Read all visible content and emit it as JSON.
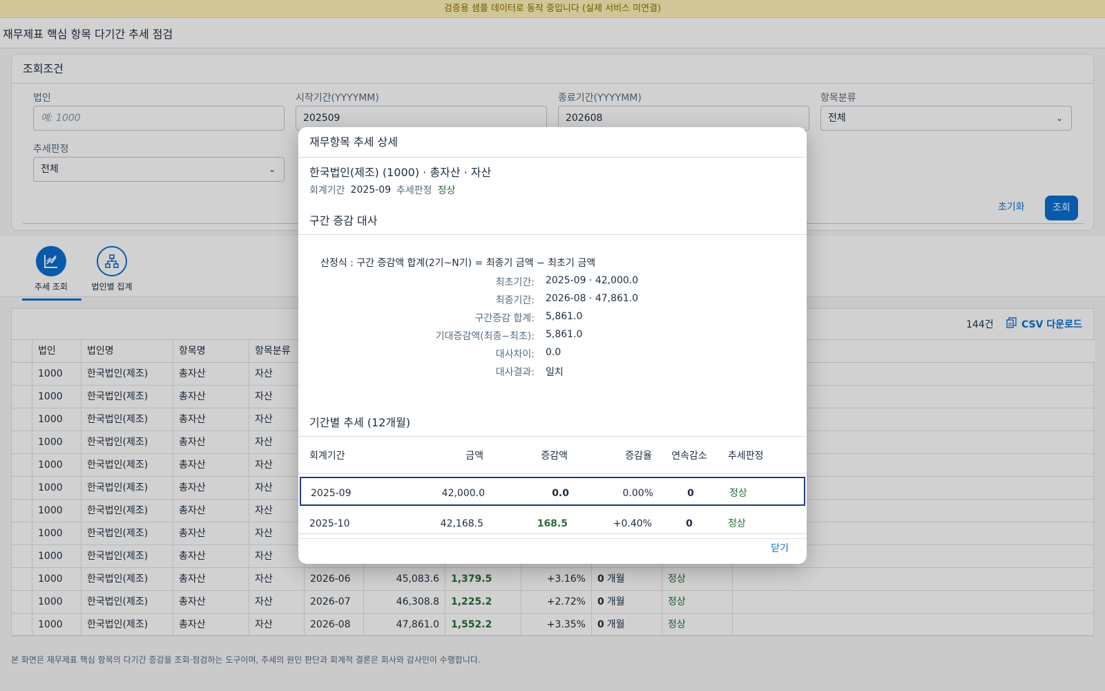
{
  "banner": "검증용 샘플 데이터로 동작 중입니다 (실제 서비스 미연결)",
  "app_title": "재무제표 핵심 항목 다기간 추세 점검",
  "filters": {
    "header": "조회조건",
    "entity_label": "법인",
    "entity_placeholder": "예: 1000",
    "start_label": "시작기간(YYYYMM)",
    "start_value": "202509",
    "end_label": "종료기간(YYYYMM)",
    "end_value": "202608",
    "category_label": "항목분류",
    "category_value": "전체",
    "trend_label": "추세판정",
    "trend_value": "전체",
    "reset_label": "초기화",
    "search_label": "조회"
  },
  "tabs": [
    {
      "label": "추세 조회",
      "icon": "line-chart-icon"
    },
    {
      "label": "법인별 집계",
      "icon": "org-hierarchy-icon"
    }
  ],
  "table": {
    "count": "144건",
    "csv_label": "CSV 다운로드",
    "columns": [
      "법인",
      "법인명",
      "항목명",
      "항목분류"
    ],
    "rows": [
      {
        "entity": "1000",
        "entity_name": "한국법인(제조)",
        "item": "총자산",
        "category": "자산",
        "period": "",
        "amount": "",
        "change": "",
        "rate": "",
        "streak": "",
        "unit": "",
        "trend": ""
      },
      {
        "entity": "1000",
        "entity_name": "한국법인(제조)",
        "item": "총자산",
        "category": "자산",
        "period": "",
        "amount": "",
        "change": "",
        "rate": "",
        "streak": "",
        "unit": "",
        "trend": ""
      },
      {
        "entity": "1000",
        "entity_name": "한국법인(제조)",
        "item": "총자산",
        "category": "자산",
        "period": "",
        "amount": "",
        "change": "",
        "rate": "",
        "streak": "",
        "unit": "",
        "trend": ""
      },
      {
        "entity": "1000",
        "entity_name": "한국법인(제조)",
        "item": "총자산",
        "category": "자산",
        "period": "",
        "amount": "",
        "change": "",
        "rate": "",
        "streak": "",
        "unit": "",
        "trend": ""
      },
      {
        "entity": "1000",
        "entity_name": "한국법인(제조)",
        "item": "총자산",
        "category": "자산",
        "period": "",
        "amount": "",
        "change": "",
        "rate": "",
        "streak": "",
        "unit": "",
        "trend": ""
      },
      {
        "entity": "1000",
        "entity_name": "한국법인(제조)",
        "item": "총자산",
        "category": "자산",
        "period": "",
        "amount": "",
        "change": "",
        "rate": "",
        "streak": "",
        "unit": "",
        "trend": ""
      },
      {
        "entity": "1000",
        "entity_name": "한국법인(제조)",
        "item": "총자산",
        "category": "자산",
        "period": "",
        "amount": "",
        "change": "",
        "rate": "",
        "streak": "",
        "unit": "",
        "trend": ""
      },
      {
        "entity": "1000",
        "entity_name": "한국법인(제조)",
        "item": "총자산",
        "category": "자산",
        "period": "",
        "amount": "",
        "change": "",
        "rate": "",
        "streak": "",
        "unit": "",
        "trend": ""
      },
      {
        "entity": "1000",
        "entity_name": "한국법인(제조)",
        "item": "총자산",
        "category": "자산",
        "period": "",
        "amount": "",
        "change": "",
        "rate": "",
        "streak": "",
        "unit": "",
        "trend": ""
      },
      {
        "entity": "1000",
        "entity_name": "한국법인(제조)",
        "item": "총자산",
        "category": "자산",
        "period": "2026-06",
        "amount": "45,083.6",
        "change": "1,379.5",
        "rate": "+3.16%",
        "streak": "0",
        "unit": "개월",
        "trend": "정상"
      },
      {
        "entity": "1000",
        "entity_name": "한국법인(제조)",
        "item": "총자산",
        "category": "자산",
        "period": "2026-07",
        "amount": "46,308.8",
        "change": "1,225.2",
        "rate": "+2.72%",
        "streak": "0",
        "unit": "개월",
        "trend": "정상"
      },
      {
        "entity": "1000",
        "entity_name": "한국법인(제조)",
        "item": "총자산",
        "category": "자산",
        "period": "2026-08",
        "amount": "47,861.0",
        "change": "1,552.2",
        "rate": "+3.35%",
        "streak": "0",
        "unit": "개월",
        "trend": "정상"
      }
    ]
  },
  "footer": "본 화면은 재무제표 핵심 항목의 다기간 증감을 조회·점검하는 도구이며, 추세의 원인 판단과 회계적 결론은 회사와 감사인이 수행합니다.",
  "dialog": {
    "title": "재무항목 추세 상세",
    "subject": "한국법인(제조) (1000) · 총자산 · 자산",
    "period_label": "회계기간",
    "period_value": "2025-09",
    "trend_label": "추세판정",
    "trend_value": "정상",
    "recon_title": "구간 증감 대사",
    "formula": "산정식 : 구간 증감액 합계(2기~N기) = 최종기 금액 − 최초기 금액",
    "kv": [
      {
        "k": "최초기간:",
        "v": "2025-09 · 42,000.0"
      },
      {
        "k": "최종기간:",
        "v": "2026-08 · 47,861.0"
      },
      {
        "k": "구간증감 합계:",
        "v": "5,861.0"
      },
      {
        "k": "기대증감액(최종−최초):",
        "v": "5,861.0"
      },
      {
        "k": "대사차이:",
        "v": "0.0"
      },
      {
        "k": "대사결과:",
        "v": "일치"
      }
    ],
    "trend_section_title": "기간별 추세 (12개월)",
    "columns": [
      "회계기간",
      "금액",
      "증감액",
      "증감율",
      "연속감소",
      "추세판정"
    ],
    "rows": [
      {
        "period": "2025-09",
        "amount": "42,000.0",
        "change": "0.0",
        "rate": "0.00%",
        "streak": "0",
        "trend": "정상"
      },
      {
        "period": "2025-10",
        "amount": "42,168.5",
        "change": "168.5",
        "rate": "+0.40%",
        "streak": "0",
        "trend": "정상"
      }
    ],
    "close_label": "닫기"
  }
}
